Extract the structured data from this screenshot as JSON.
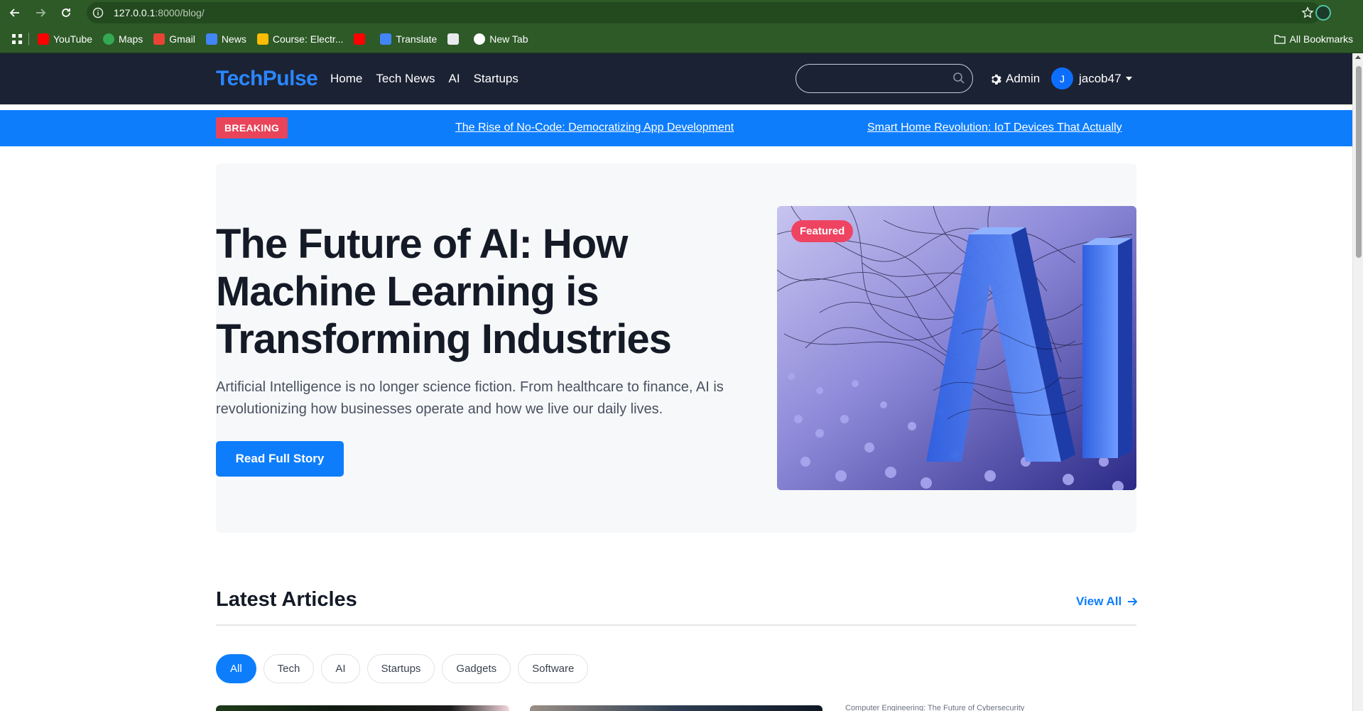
{
  "browser": {
    "url_host": "127.0.0.1",
    "url_path": ":8000/blog/",
    "bookmarks": [
      {
        "label": "YouTube",
        "icon": "youtube-icon",
        "color": "#ff0000"
      },
      {
        "label": "Maps",
        "icon": "maps-icon",
        "color": "#34a853"
      },
      {
        "label": "Gmail",
        "icon": "gmail-icon",
        "color": "#ea4335"
      },
      {
        "label": "News",
        "icon": "news-icon",
        "color": "#4285f4"
      },
      {
        "label": "Course: Electr...",
        "icon": "course-icon",
        "color": "#fbbc04"
      },
      {
        "label": "",
        "icon": "youtube-icon",
        "color": "#ff0000"
      },
      {
        "label": "Translate",
        "icon": "translate-icon",
        "color": "#4285f4"
      },
      {
        "label": "",
        "icon": "docs-icon",
        "color": "#e8eaed"
      },
      {
        "label": "New Tab",
        "icon": "newtab-icon",
        "color": "#ffffff"
      }
    ],
    "all_bookmarks": "All Bookmarks"
  },
  "nav": {
    "logo": "TechPulse",
    "links": [
      "Home",
      "Tech News",
      "AI",
      "Startups"
    ],
    "admin": "Admin",
    "avatar_initial": "J",
    "username": "jacob47"
  },
  "breaking": {
    "badge": "BREAKING",
    "items": [
      "The Rise of No-Code: Democratizing App Development",
      "Smart Home Revolution: IoT Devices That Actually"
    ]
  },
  "hero": {
    "title": "The Future of AI: How Machine Learning is Transforming Industries",
    "description": "Artificial Intelligence is no longer science fiction. From healthcare to finance, AI is revolutionizing how businesses operate and how we live our daily lives.",
    "button": "Read Full Story",
    "badge": "Featured"
  },
  "latest": {
    "title": "Latest Articles",
    "view_all": "View All",
    "filters": [
      "All",
      "Tech",
      "AI",
      "Startups",
      "Gadgets",
      "Software"
    ],
    "active_filter": "All",
    "card3_alt": "Computer Engineering: The Future of Cybersecurity"
  },
  "colors": {
    "accent": "#0d7dfc",
    "nav_bg": "#1b2233",
    "breaking_badge": "#e8445a",
    "featured_badge": "#ef4461"
  }
}
